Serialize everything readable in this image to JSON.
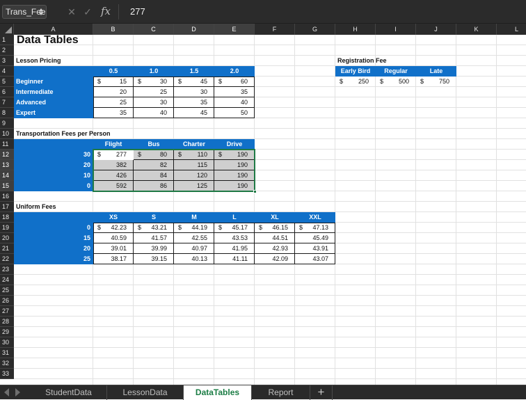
{
  "formula_bar": {
    "name_box": "Trans_Fee",
    "formula_value": "277",
    "fx_label": "fx",
    "cancel_glyph": "✕",
    "enter_glyph": "✓"
  },
  "columns": [
    "A",
    "B",
    "C",
    "D",
    "E",
    "F",
    "G",
    "H",
    "I",
    "J",
    "K",
    "L"
  ],
  "selected_columns": [
    "B",
    "C",
    "D",
    "E"
  ],
  "rows": [
    "1",
    "2",
    "3",
    "4",
    "5",
    "6",
    "7",
    "8",
    "9",
    "10",
    "11",
    "12",
    "13",
    "14",
    "15",
    "16",
    "17",
    "18",
    "19",
    "20",
    "21",
    "22",
    "23",
    "24",
    "25",
    "26",
    "27",
    "28",
    "29",
    "30",
    "31",
    "32",
    "33"
  ],
  "selected_rows": [
    "12",
    "13",
    "14",
    "15"
  ],
  "title": "Data Tables",
  "currency": "$",
  "lesson_pricing": {
    "label": "Lesson Pricing",
    "headers": [
      "0.5",
      "1.0",
      "1.5",
      "2.0"
    ],
    "row_labels": [
      "Beginner",
      "Intermediate",
      "Advanced",
      "Expert"
    ],
    "values": [
      [
        "15",
        "30",
        "45",
        "60"
      ],
      [
        "20",
        "25",
        "30",
        "35"
      ],
      [
        "25",
        "30",
        "35",
        "40"
      ],
      [
        "35",
        "40",
        "45",
        "50"
      ]
    ]
  },
  "registration_fee": {
    "label": "Registration Fee",
    "headers": [
      "Early Bird",
      "Regular",
      "Late"
    ],
    "values": [
      "250",
      "500",
      "750"
    ]
  },
  "transportation": {
    "label": "Transportation Fees per Person",
    "headers": [
      "Flight",
      "Bus",
      "Charter",
      "Drive"
    ],
    "row_labels": [
      "30",
      "20",
      "10",
      "0"
    ],
    "values": [
      [
        "277",
        "80",
        "110",
        "190"
      ],
      [
        "382",
        "82",
        "115",
        "190"
      ],
      [
        "426",
        "84",
        "120",
        "190"
      ],
      [
        "592",
        "86",
        "125",
        "190"
      ]
    ]
  },
  "uniform": {
    "label": "Uniform Fees",
    "headers": [
      "XS",
      "S",
      "M",
      "L",
      "XL",
      "XXL"
    ],
    "row_labels": [
      "0",
      "15",
      "20",
      "25"
    ],
    "values": [
      [
        "42.23",
        "43.21",
        "44.19",
        "45.17",
        "46.15",
        "47.13"
      ],
      [
        "40.59",
        "41.57",
        "42.55",
        "43.53",
        "44.51",
        "45.49"
      ],
      [
        "39.01",
        "39.99",
        "40.97",
        "41.95",
        "42.93",
        "43.91"
      ],
      [
        "38.17",
        "39.15",
        "40.13",
        "41.11",
        "42.09",
        "43.07"
      ]
    ]
  },
  "sheet_tabs": [
    {
      "label": "StudentData",
      "active": false
    },
    {
      "label": "LessonData",
      "active": false
    },
    {
      "label": "DataTables",
      "active": true
    },
    {
      "label": "Report",
      "active": false
    }
  ],
  "add_tab_label": "+",
  "colors": {
    "accent_fill": "#1070c9",
    "selection": "#1f7a45",
    "data_table_gray": "#cfcfcf",
    "active_tab_text": "#1b7d45"
  },
  "icons": {
    "name_box_spinner": "stepper-icon",
    "cancel": "cancel-icon",
    "enter": "enter-icon",
    "fx": "function-icon",
    "tab_prev": "arrow-left-icon",
    "tab_next": "arrow-right-icon"
  }
}
